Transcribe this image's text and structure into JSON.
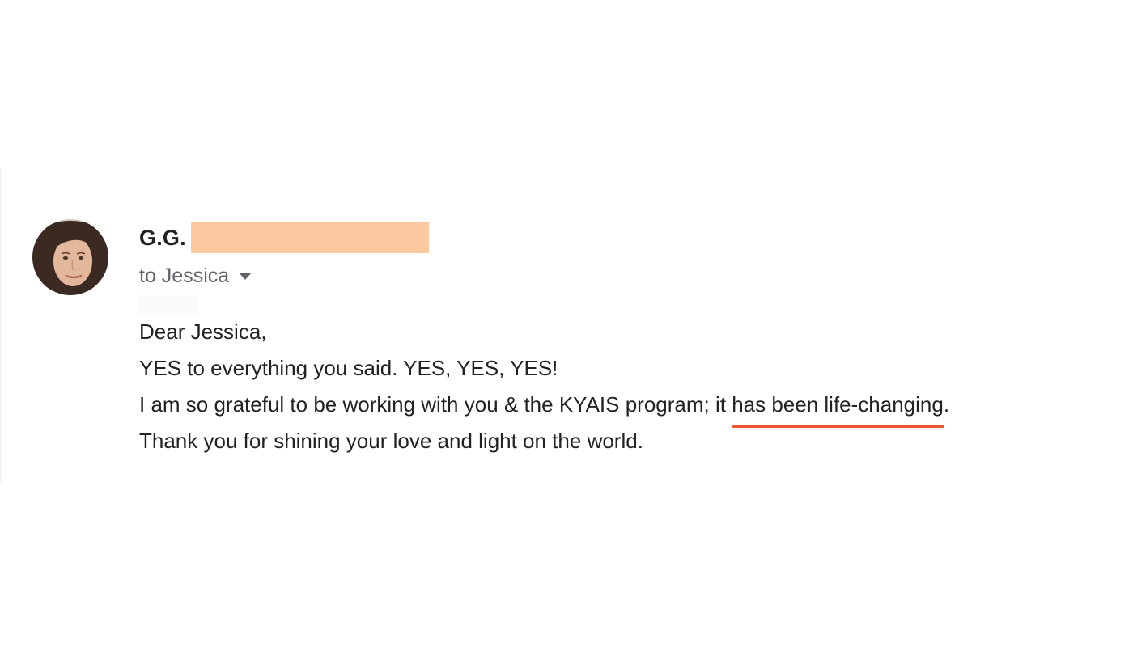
{
  "email": {
    "sender": {
      "name": "G.G."
    },
    "recipient": {
      "label": "to Jessica",
      "dropdown_icon": "caret-down-icon"
    },
    "body": {
      "greeting": "Dear Jessica,",
      "line2": "YES to everything you said. YES, YES, YES!",
      "line3_before": "I am so grateful to be working with you & the KYAIS program; it ",
      "line3_highlight": "has been life-changing",
      "line3_after": ".",
      "line4": "Thank you for shining your love and light on the world."
    }
  },
  "colors": {
    "redaction": "#fcc8a0",
    "underline": "#e8582f",
    "text": "#222222",
    "secondary_text": "#5f6368"
  }
}
